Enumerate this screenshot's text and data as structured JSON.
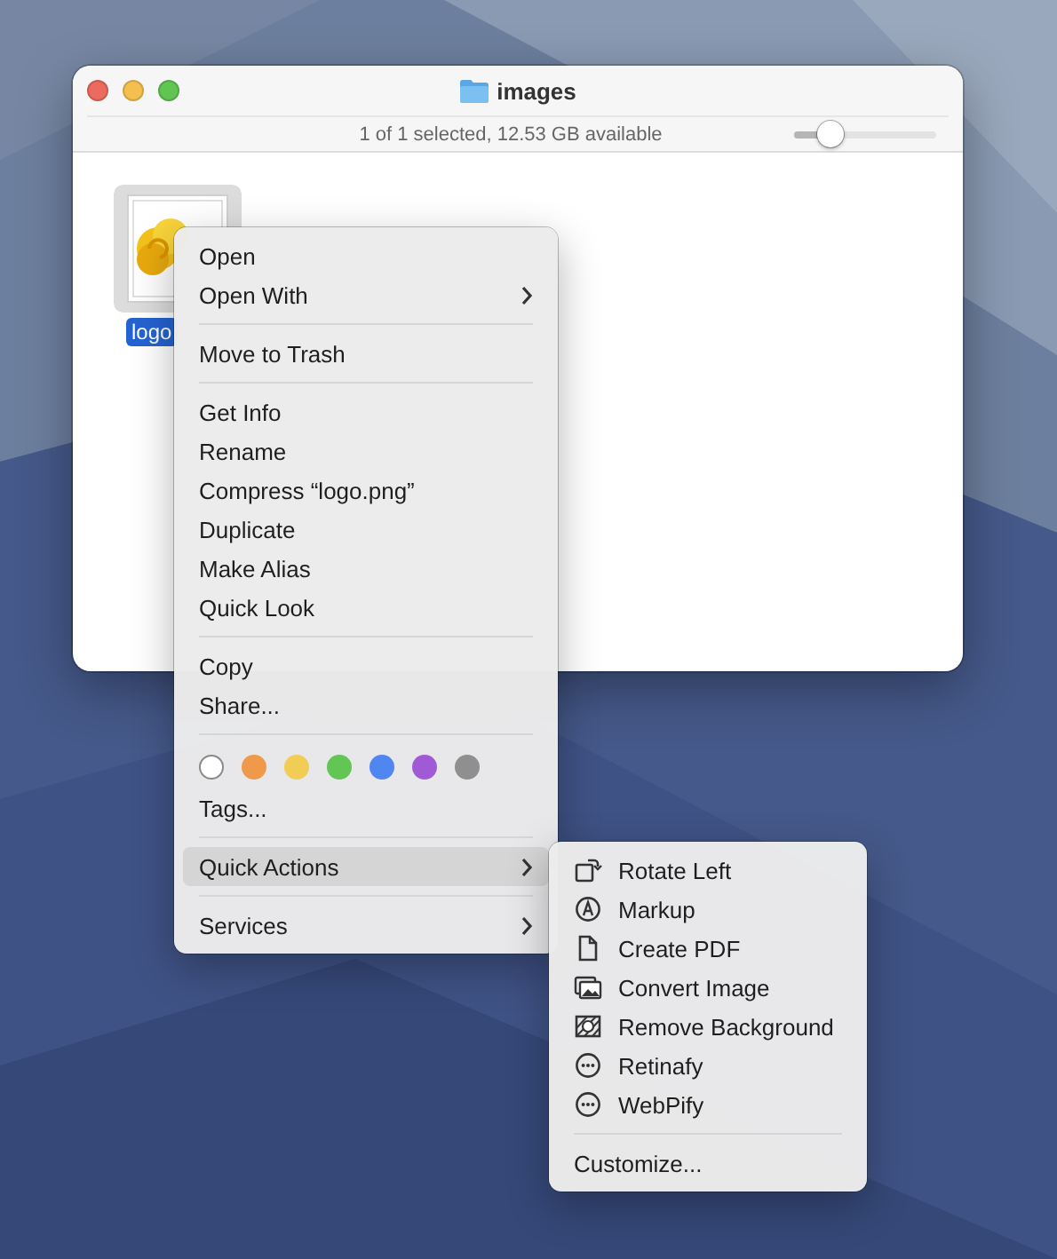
{
  "window": {
    "title": "images",
    "status": "1 of 1 selected, 12.53 GB available",
    "zoom_slider": {
      "level": 0.25
    },
    "controls": [
      {
        "kind": "close"
      },
      {
        "kind": "minimize"
      },
      {
        "kind": "zoom"
      }
    ],
    "files": [
      {
        "name": "logo",
        "selected": true
      }
    ]
  },
  "context_menu": {
    "items": [
      {
        "kind": "item",
        "label": "Open",
        "selected": false,
        "submenu": false
      },
      {
        "kind": "item",
        "label": "Open With",
        "selected": false,
        "submenu": true
      },
      {
        "kind": "separator"
      },
      {
        "kind": "item",
        "label": "Move to Trash",
        "selected": false,
        "submenu": false
      },
      {
        "kind": "separator"
      },
      {
        "kind": "item",
        "label": "Get Info",
        "selected": false,
        "submenu": false
      },
      {
        "kind": "item",
        "label": "Rename",
        "selected": false,
        "submenu": false
      },
      {
        "kind": "item",
        "label": "Compress “logo.png”",
        "selected": false,
        "submenu": false
      },
      {
        "kind": "item",
        "label": "Duplicate",
        "selected": false,
        "submenu": false
      },
      {
        "kind": "item",
        "label": "Make Alias",
        "selected": false,
        "submenu": false
      },
      {
        "kind": "item",
        "label": "Quick Look",
        "selected": false,
        "submenu": false
      },
      {
        "kind": "separator"
      },
      {
        "kind": "item",
        "label": "Copy",
        "selected": false,
        "submenu": false
      },
      {
        "kind": "item",
        "label": "Share...",
        "selected": false,
        "submenu": false
      },
      {
        "kind": "separator"
      },
      {
        "kind": "tags",
        "tags": [
          {
            "kind": "none"
          },
          {
            "kind": "color",
            "color": "#ef9a4b"
          },
          {
            "kind": "color",
            "color": "#f2cd55"
          },
          {
            "kind": "color",
            "color": "#62c554"
          },
          {
            "kind": "color",
            "color": "#4f86ef"
          },
          {
            "kind": "color",
            "color": "#a15ad5"
          },
          {
            "kind": "color",
            "color": "#8f8f8f"
          }
        ]
      },
      {
        "kind": "item",
        "label": "Tags...",
        "selected": false,
        "submenu": false
      },
      {
        "kind": "separator"
      },
      {
        "kind": "item",
        "label": "Quick Actions",
        "selected": true,
        "submenu": true
      },
      {
        "kind": "separator"
      },
      {
        "kind": "item",
        "label": "Services",
        "selected": false,
        "submenu": true
      }
    ]
  },
  "quick_actions_menu": {
    "items": [
      {
        "kind": "rotate",
        "label": "Rotate Left",
        "selected": false
      },
      {
        "kind": "markup",
        "label": "Markup",
        "selected": false
      },
      {
        "kind": "document",
        "label": "Create PDF",
        "selected": false
      },
      {
        "kind": "images",
        "label": "Convert Image",
        "selected": false
      },
      {
        "kind": "remove-background",
        "label": "Remove Background",
        "selected": false
      },
      {
        "kind": "more",
        "label": "Retinafy",
        "selected": false
      },
      {
        "kind": "more",
        "label": "WebPify",
        "selected": false
      },
      {
        "kind": "separator"
      },
      {
        "kind": "item",
        "label": "Customize...",
        "selected": false
      }
    ]
  }
}
